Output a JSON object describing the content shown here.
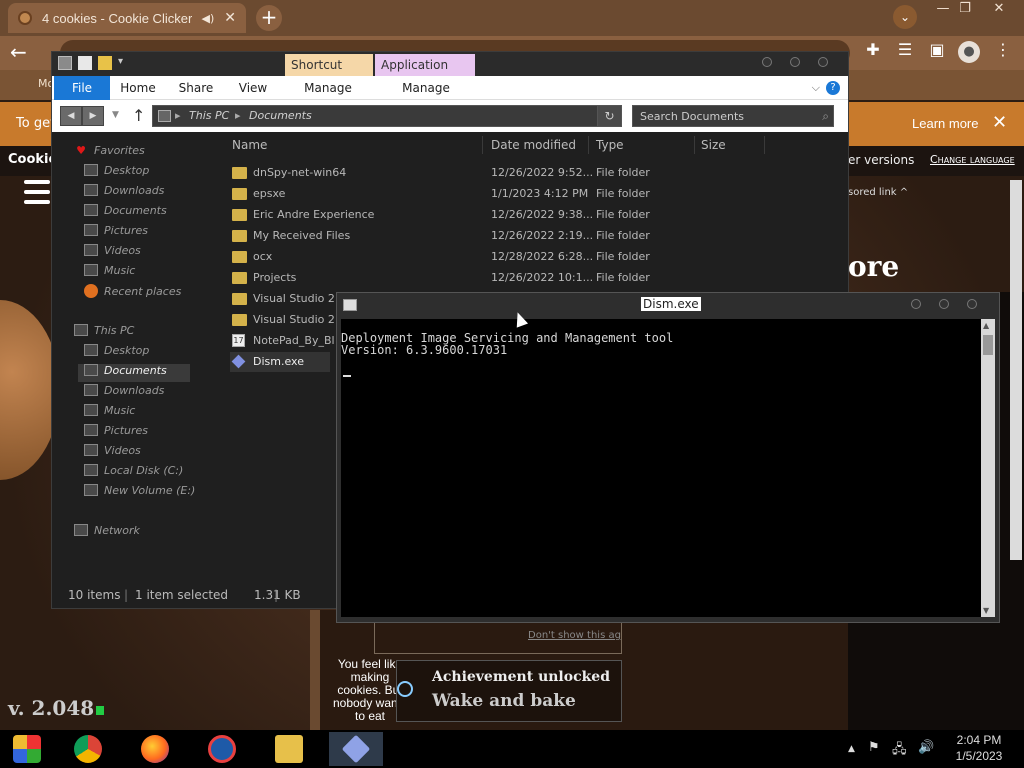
{
  "browser": {
    "tab_title": "4 cookies - Cookie Clicker",
    "new_tab": "+",
    "window_controls": {
      "minimize": "—",
      "restore": "❐",
      "close": "✕"
    },
    "nav_back": "←",
    "bookmark_fragment": "Mo",
    "icons": [
      "puzzle-icon",
      "reading-list-icon",
      "sidepanel-icon",
      "avatar-icon",
      "more-icon"
    ]
  },
  "cookieclicker": {
    "banner_left": "To get",
    "banner_learn_more": "Learn more",
    "banner_close": "✕",
    "brand": "Cookie",
    "other_versions": "er versions",
    "change_language": "Change language",
    "sponsored": "sored link ^",
    "store_heading": "ore",
    "dont_show": "Don't show this ag",
    "side_note": "You feel like making cookies. But nobody wants to eat",
    "achievement_title": "Achievement unlocked",
    "achievement_name": "Wake and bake",
    "version": "v. 2.048"
  },
  "explorer": {
    "context_tabs": [
      "Shortcut Tools",
      "Application Tools"
    ],
    "ribbon": {
      "file": "File",
      "home": "Home",
      "share": "Share",
      "view": "View",
      "manage1": "Manage",
      "manage2": "Manage",
      "chevron": "⌵",
      "help": "?"
    },
    "breadcrumb": [
      "This PC",
      "Documents"
    ],
    "search_placeholder": "Search Documents",
    "nav": {
      "favorites": "Favorites",
      "fav_items": [
        "Desktop",
        "Downloads",
        "Documents",
        "Pictures",
        "Videos",
        "Music",
        "Recent places"
      ],
      "this_pc": "This PC",
      "pc_items": [
        "Desktop",
        "Documents",
        "Downloads",
        "Music",
        "Pictures",
        "Videos",
        "Local Disk (C:)",
        "New Volume (E:)"
      ],
      "network": "Network"
    },
    "columns": [
      "Name",
      "Date modified",
      "Type",
      "Size"
    ],
    "rows": [
      {
        "name": "dnSpy-net-win64",
        "date": "12/26/2022 9:52...",
        "type": "File folder"
      },
      {
        "name": "epsxe",
        "date": "1/1/2023 4:12 PM",
        "type": "File folder"
      },
      {
        "name": "Eric Andre Experience",
        "date": "12/26/2022 9:38...",
        "type": "File folder"
      },
      {
        "name": "My Received Files",
        "date": "12/26/2022 2:19...",
        "type": "File folder"
      },
      {
        "name": "ocx",
        "date": "12/28/2022 6:28...",
        "type": "File folder"
      },
      {
        "name": "Projects",
        "date": "12/26/2022 10:1...",
        "type": "File folder"
      },
      {
        "name": "Visual Studio 2",
        "date": "",
        "type": ""
      },
      {
        "name": "Visual Studio 2",
        "date": "",
        "type": ""
      },
      {
        "name": "NotePad_By_Bl",
        "date": "",
        "type": ""
      },
      {
        "name": "Dism.exe",
        "date": "",
        "type": ""
      }
    ],
    "status": {
      "items": "10 items",
      "selected": "1 item selected",
      "size": "1.31 KB"
    }
  },
  "console": {
    "title": "Dism.exe",
    "lines": [
      "Deployment Image Servicing and Management tool",
      "Version: 6.3.9600.17031"
    ]
  },
  "taskbar": {
    "apps": [
      "start-icon",
      "chrome-icon",
      "firefox-icon",
      "edge-icon",
      "file-explorer-icon",
      "dism-icon"
    ],
    "tray": {
      "chevron": "▲",
      "flag": "⚑",
      "network": "🖧",
      "volume": "🔊"
    },
    "time": "2:04 PM",
    "date": "1/5/2023"
  },
  "colors": {
    "accent_blue": "#1a78d6",
    "shortcut_tab": "#f5d7a8",
    "application_tab": "#e8c6f0",
    "banner_orange": "#c87a2c"
  }
}
